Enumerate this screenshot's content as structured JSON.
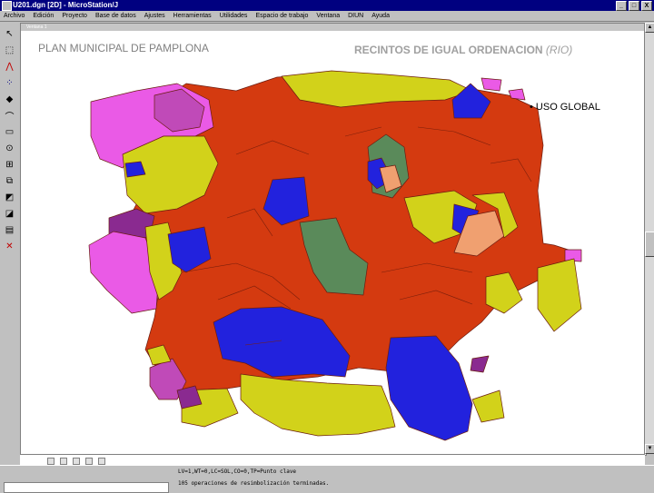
{
  "window": {
    "title": "U201.dgn [2D] - MicroStation/J",
    "controls": [
      "_",
      "□",
      "X"
    ]
  },
  "menu": [
    "Archivo",
    "Edición",
    "Proyecto",
    "Base de datos",
    "Ajustes",
    "Herramientas",
    "Utilidades",
    "Espacio de trabajo",
    "Ventana",
    "DIUN",
    "Ayuda"
  ],
  "view": {
    "title": "Ventana 1",
    "header_left": "PLAN MUNICIPAL DE PAMPLONA",
    "header_right": "RECINTOS DE IGUAL ORDENACION",
    "header_right_suffix": "(RIO)",
    "legend_bullet": "• USO GLOBAL"
  },
  "status": {
    "line1": "LV=1,WT=0,LC=SOL,CO=0,TP=Punto clave",
    "line2": "105 operaciones de resimbolización terminadas."
  },
  "tools": [
    {
      "name": "element-selection-tool-icon",
      "glyph": "↖"
    },
    {
      "name": "fence-tool-icon",
      "glyph": "⬚"
    },
    {
      "name": "line-tool-icon",
      "glyph": "⋀"
    },
    {
      "name": "points-tool-icon",
      "glyph": "⁘"
    },
    {
      "name": "shape-tool-icon",
      "glyph": "◆"
    },
    {
      "name": "arc-tool-icon",
      "glyph": "⌒"
    },
    {
      "name": "polygon-tool-icon",
      "glyph": "▭"
    },
    {
      "name": "zoom-tool-icon",
      "glyph": "⊙"
    },
    {
      "name": "grid-tool-icon",
      "glyph": "⊞"
    },
    {
      "name": "copy-tool-icon",
      "glyph": "⧉"
    },
    {
      "name": "modify-tool-icon",
      "glyph": "◩"
    },
    {
      "name": "measure-tool-icon",
      "glyph": "◪"
    },
    {
      "name": "chart-tool-icon",
      "glyph": "▤"
    },
    {
      "name": "delete-tool-icon",
      "glyph": "✕"
    }
  ],
  "colors": {
    "urban": "#d43a10",
    "industrial": "#2222dd",
    "green": "#5a8a5a",
    "rural": "#d2d21a",
    "special": "#ea5ae6",
    "institutional": "#8a2a90",
    "transport": "#f0a070"
  }
}
